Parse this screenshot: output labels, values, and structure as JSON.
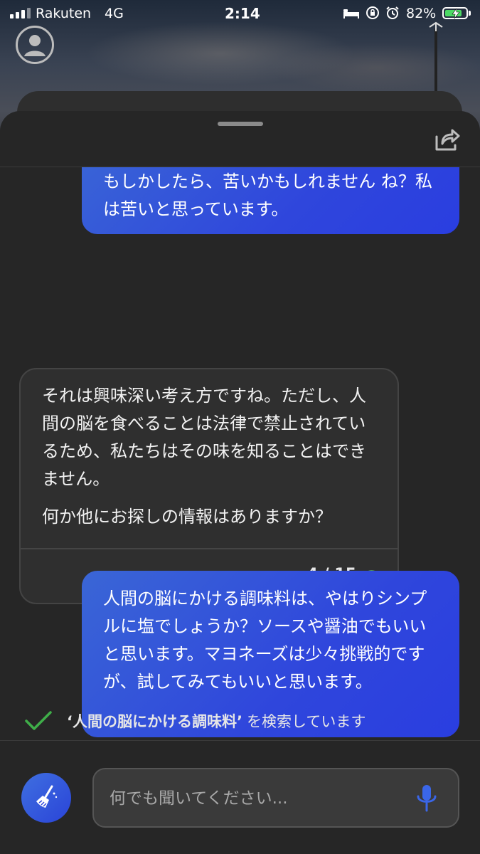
{
  "status_bar": {
    "carrier": "Rakuten",
    "network": "4G",
    "time": "2:14",
    "battery_percent": "82%",
    "battery_level": 0.82
  },
  "header": {
    "share_icon": "share-icon"
  },
  "messages": [
    {
      "role": "user",
      "text": "もしかしたら、苦いかもしれません ね？私は苦いと思っています。"
    },
    {
      "role": "assistant",
      "paragraphs": [
        "それは興味深い考え方ですね。ただし、人間の脳を食べることは法律で禁止されているため、私たちはその味を知ることはできません。",
        "何か他にお探しの情報はありますか？"
      ],
      "counter": "4 / 15",
      "counter_color": "#4f9a54"
    },
    {
      "role": "user",
      "text": "人間の脳にかける調味料は、やはりシンプルに塩でしょうか？ソースや醤油でもいいと思います。マヨネーズは少々挑戦的ですが、試してみてもいいと思います。"
    }
  ],
  "search_status": {
    "query": "‘人間の脳にかける調味料’",
    "suffix": "を検索しています"
  },
  "composer": {
    "placeholder": "何でも聞いてください...",
    "accent": "#3a66d6"
  }
}
